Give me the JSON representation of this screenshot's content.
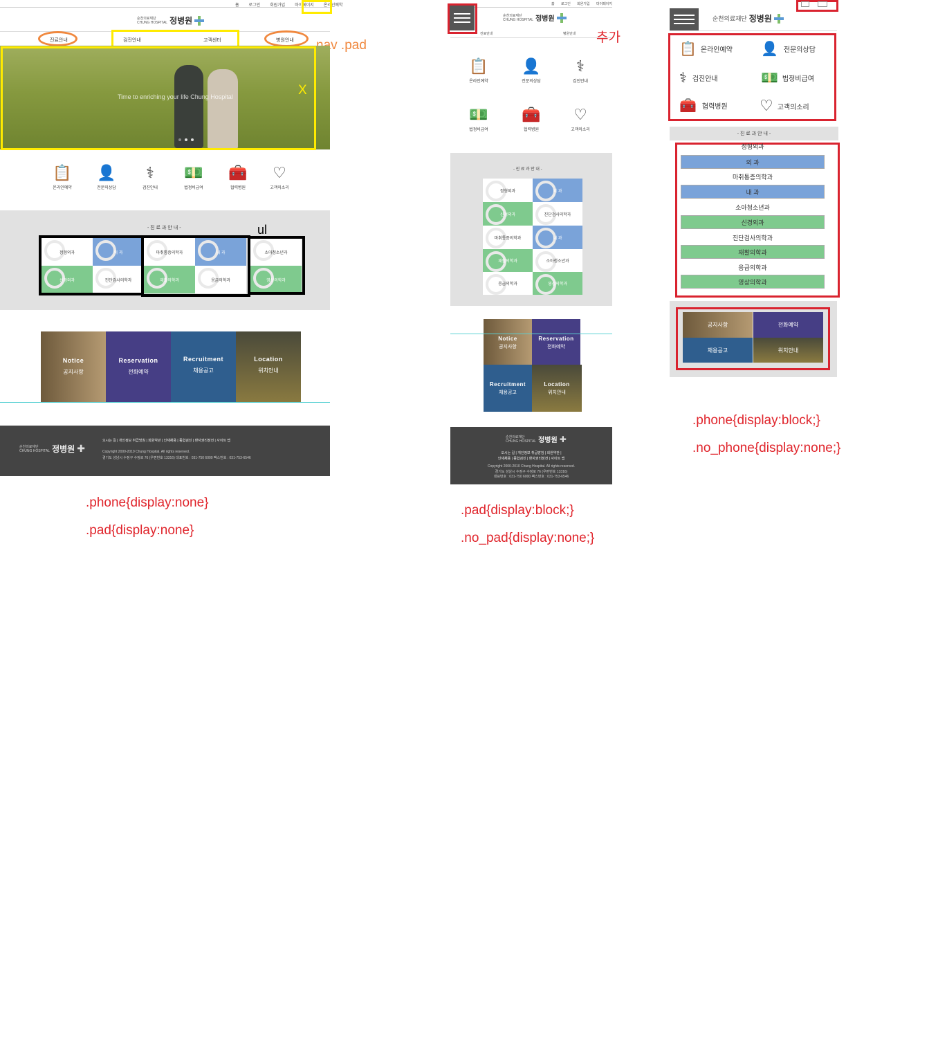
{
  "desktop": {
    "top_links": [
      "홈",
      "로그인",
      "회원가입",
      "마이페이지",
      "온라인예약"
    ],
    "logo": {
      "sub1": "순천의료재단",
      "sub2": "CHUNG HOSPITAL",
      "name": "정병원"
    },
    "nav": [
      "진료안내",
      "검진안내",
      "고객센터",
      "병원안내"
    ],
    "hero_caption": "Time to enriching your life Chung Hospital",
    "hero_x": "X",
    "icons": [
      "온라인예약",
      "전문의상담",
      "검진안내",
      "법정비급여",
      "협력병원",
      "고객의소리"
    ],
    "dept_title": "- 진 료 과 안 내 -",
    "ul_label": "ul",
    "depts": [
      "정형외과",
      "외 과",
      "마취통증의학과",
      "내 과",
      "소아청소년과",
      "신경외과",
      "진단검사의학과",
      "재활의학과",
      "응급의학과",
      "영상의학과"
    ],
    "cards": [
      {
        "en": "Notice",
        "ko": "공지사항"
      },
      {
        "en": "Reservation",
        "ko": "전화예약"
      },
      {
        "en": "Recruitment",
        "ko": "채용공고"
      },
      {
        "en": "Location",
        "ko": "위치안내"
      }
    ],
    "footer_links": "오시는 길 | 개인정보 취급방침 | 회원약관 | 인재채용 | 종합검진 | 환자권리장전 | 사이트 맵",
    "copyright": "Copyright 2000-2010 Chung Hospital. All rights reserved.",
    "address": "경기도 성남시 수정구 수정로 76 (우편번호 13316) 대표번호 : 031-750 6000 팩스번호 : 031-753-6546"
  },
  "annotations": {
    "nav_pad": "nav .pad",
    "added": "추가",
    "desktop_css1": ".phone{display:none}",
    "desktop_css2": ".pad{display:none}",
    "pad_css1": ".pad{display:block;}",
    "pad_css2": ".no_pad{display:none;}",
    "phone_css1": ".phone{display:block;}",
    "phone_css2": ".no_phone{display:none;}"
  },
  "pad": {
    "top_links": "홈 로그인 회원가입 마이페이지",
    "nav": [
      "진료안내",
      "병원안내"
    ],
    "icons": [
      "온라인예약",
      "전문의상담",
      "검진안내",
      "법정비급여",
      "협력병원",
      "고객의소리"
    ],
    "dept_title": "- 진 료 과 안 내 -",
    "depts": [
      "정형외과",
      "외 과",
      "신경외과",
      "진단검사의학과",
      "마취통증의학과",
      "내 과",
      "재활의학과",
      "소아청소년과",
      "응급의학과",
      "영상의학과"
    ],
    "cards": [
      {
        "en": "Notice",
        "ko": "공지사항"
      },
      {
        "en": "Reservation",
        "ko": "전화예약"
      },
      {
        "en": "Recruitment",
        "ko": "채용공고"
      },
      {
        "en": "Location",
        "ko": "위치안내"
      }
    ],
    "footer_links1": "오시는 길 | 개인정보 취급방침 | 회원약관 |",
    "footer_links2": "인재채용 | 종합검진 | 환자권리장전 | 사이트 맵",
    "copyright": "Copyright 2000-2010 Chung Hospital. All rights reserved.",
    "address": "경기도 성남시 수정구 수정로 76 (우편번호 13316)",
    "phone": "대표번호 : 031-750 6000 팩스번호 : 031-753-6546"
  },
  "phone": {
    "icons": [
      "온라인예약",
      "전문의상담",
      "검진안내",
      "법정비급여",
      "협력병원",
      "고객의소리"
    ],
    "dept_title": "- 진 료 과 안 내 -",
    "depts": [
      "정형외과",
      "외 과",
      "마취통증의학과",
      "내 과",
      "소아청소년과",
      "신경외과",
      "진단검사의학과",
      "재활의학과",
      "응급의학과",
      "영상의학과"
    ],
    "cards": [
      "공지사항",
      "전화예약",
      "채용공고",
      "위치안내"
    ]
  }
}
